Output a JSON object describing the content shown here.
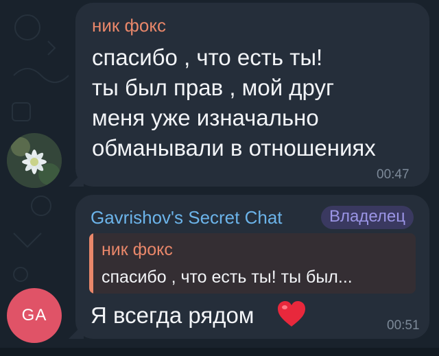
{
  "chat": {
    "message1": {
      "sender": "ник фокс",
      "lines": [
        "спасибо , что есть ты!",
        "ты был прав , мой друг",
        "меня уже изначально",
        "обманывали в отношениях"
      ],
      "time": "00:47"
    },
    "message2": {
      "sender": "Gavrishov's Secret Chat",
      "role_badge": "Владелец",
      "reply": {
        "sender": "ник фокс",
        "text": "спасибо , что есть ты!  ты был..."
      },
      "text": "Я всегда рядом",
      "emoji": "heart-emoji",
      "time": "00:51",
      "avatar_initials": "GA"
    }
  },
  "colors": {
    "background": "#19222c",
    "bubble": "#252e3a",
    "sender_orange": "#e9876a",
    "sender_blue": "#6cb4ea",
    "badge_purple": "#9b95e6",
    "avatar_pink": "#e05367"
  },
  "icons": [
    "flower-avatar-icon",
    "heart-emoji-icon"
  ]
}
